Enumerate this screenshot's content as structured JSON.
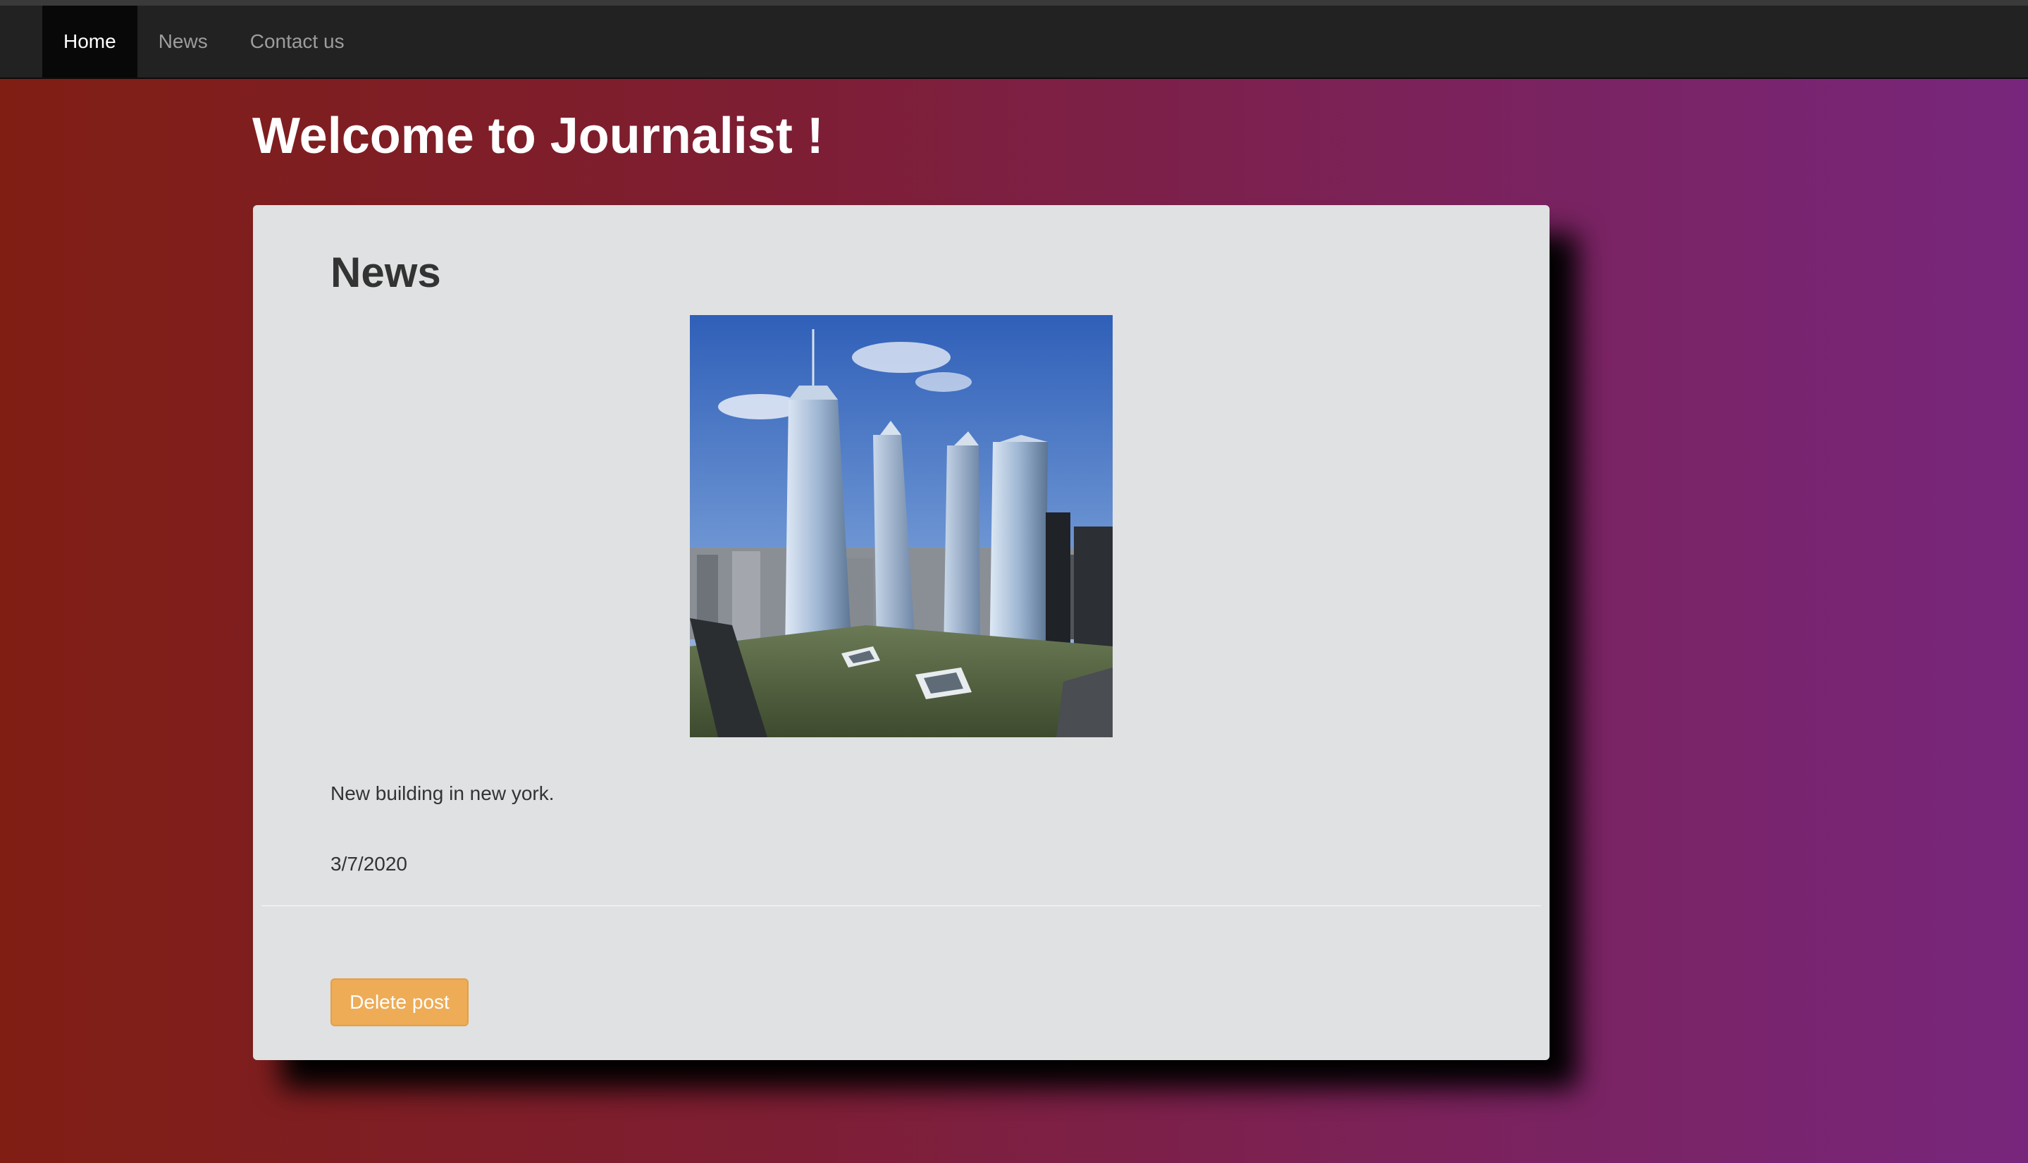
{
  "navbar": {
    "items": [
      {
        "label": "Home",
        "active": true
      },
      {
        "label": "News",
        "active": false
      },
      {
        "label": "Contact us",
        "active": false
      }
    ]
  },
  "page": {
    "title": "Welcome to Journalist !"
  },
  "post": {
    "section_title": "News",
    "description": "New building in new york.",
    "date": "3/7/2020",
    "delete_label": "Delete post"
  },
  "colors": {
    "navbar_bg": "#222222",
    "nav_active_bg": "#080808",
    "card_bg": "#dfe1e2",
    "button": "#eeac57",
    "gradient_left": "#801e14",
    "gradient_right": "#78267c"
  }
}
